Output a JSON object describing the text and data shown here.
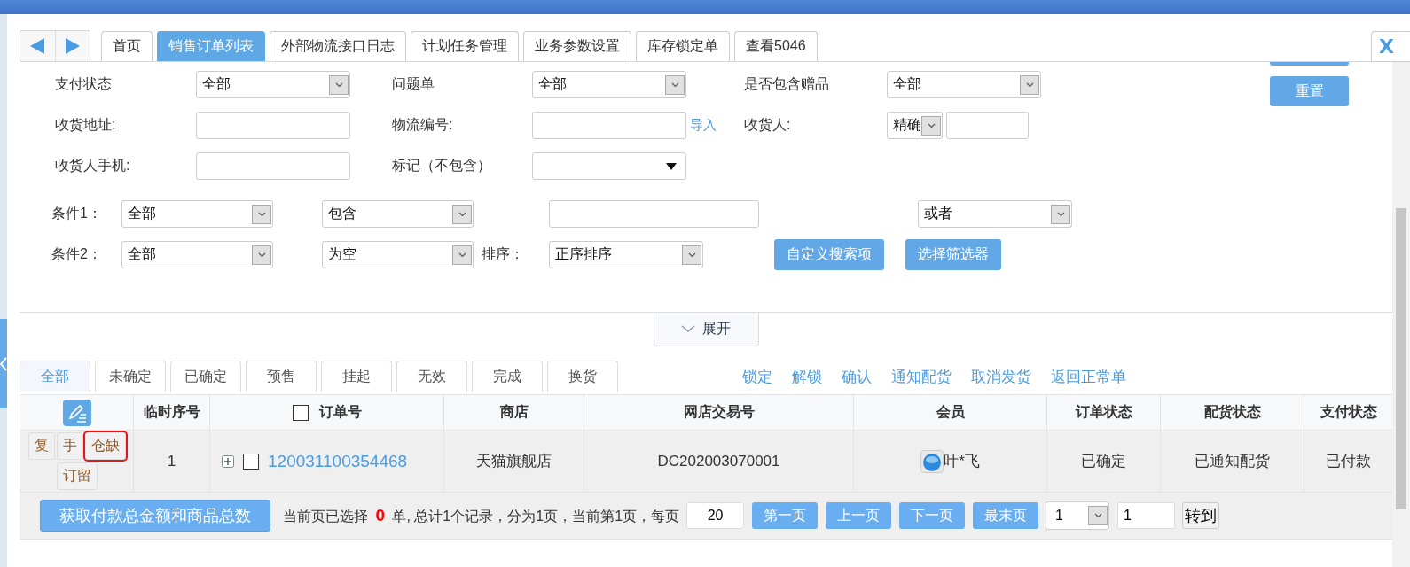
{
  "tabs": [
    {
      "label": "首页",
      "selected": false
    },
    {
      "label": "销售订单列表",
      "selected": true
    },
    {
      "label": "外部物流接口日志",
      "selected": false
    },
    {
      "label": "计划任务管理",
      "selected": false
    },
    {
      "label": "业务参数设置",
      "selected": false
    },
    {
      "label": "库存锁定单",
      "selected": false
    },
    {
      "label": "查看5046",
      "selected": false
    }
  ],
  "close_button": "X",
  "filters": [
    [
      {
        "label": "支付状态",
        "kind": "select",
        "value": "全部"
      },
      {
        "label": "问题单",
        "kind": "select",
        "value": "全部"
      },
      {
        "label": "是否包含赠品",
        "kind": "select",
        "value": "全部"
      }
    ],
    [
      {
        "label": "收货地址:",
        "kind": "input"
      },
      {
        "label": "物流编号:",
        "kind": "input",
        "link": "导入"
      },
      {
        "label": "收货人:",
        "kind": "select_input",
        "value": "精确"
      }
    ],
    [
      {
        "label": "收货人手机:",
        "kind": "input"
      },
      {
        "label": "标记（不包含）",
        "kind": "dropdown"
      }
    ]
  ],
  "reset_button": "重置",
  "conditions": [
    {
      "label": "条件1：",
      "field": "全部",
      "operator": "包含"
    },
    {
      "label": "条件2：",
      "field": "全部",
      "operator": "为空"
    }
  ],
  "logic": "或者",
  "sort": {
    "label": "排序：",
    "value": "正序排序"
  },
  "search_buttons": [
    "自定义搜索项",
    "选择筛选器"
  ],
  "expand_button": "展开",
  "status_tabs": [
    {
      "label": "全部",
      "selected": true
    },
    {
      "label": "未确定",
      "selected": false
    },
    {
      "label": "已确定",
      "selected": false
    },
    {
      "label": "预售",
      "selected": false
    },
    {
      "label": "挂起",
      "selected": false
    },
    {
      "label": "无效",
      "selected": false
    },
    {
      "label": "完成",
      "selected": false
    },
    {
      "label": "换货",
      "selected": false
    }
  ],
  "actions": [
    "锁定",
    "解锁",
    "确认",
    "通知配货",
    "取消发货",
    "返回正常单"
  ],
  "table": {
    "columns": [
      "临时序号",
      "订单号",
      "商店",
      "网店交易号",
      "会员",
      "订单状态",
      "配货状态",
      "支付状态"
    ],
    "header_checked": false,
    "rows": [
      {
        "buttons": [
          {
            "label": "复",
            "outlined": false
          },
          {
            "label": "手",
            "outlined": false
          },
          {
            "label": "仓缺",
            "outlined": true
          },
          {
            "label": "订留",
            "outlined": false
          }
        ],
        "seq": "1",
        "expanded": false,
        "checked": false,
        "order_no": "120031100354468",
        "shop": "天猫旗舰店",
        "trade_no": "DC202003070001",
        "member": "叶*飞",
        "order_status": "已确定",
        "allocation_status": "已通知配货",
        "payment_status": "已付款"
      }
    ]
  },
  "footer": {
    "button": "获取付款总金额和商品总数",
    "summary": "当前页已选择 **0** 单, 总计1个记录，分为1页，当前第1页，每页",
    "page_size": "20",
    "pager_buttons": [
      "第一页",
      "上一页",
      "下一页",
      "最末页"
    ],
    "page_select": "1",
    "page_input": "1",
    "go_button": "转到"
  }
}
